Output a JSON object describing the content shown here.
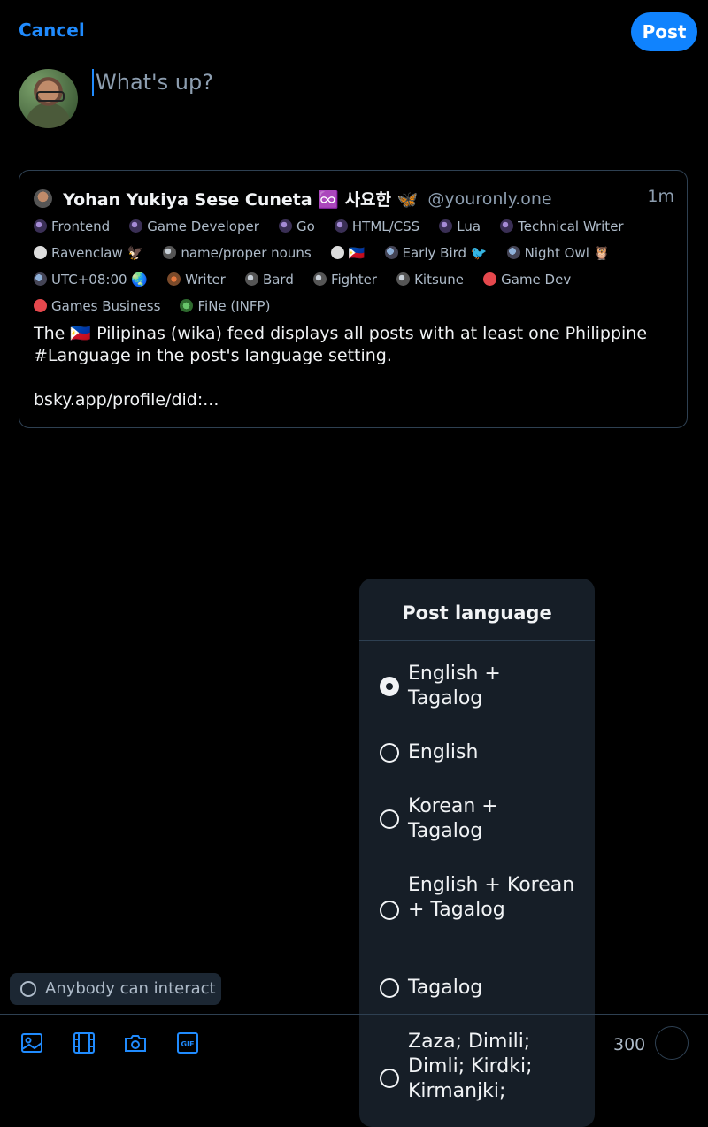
{
  "topbar": {
    "cancel_label": "Cancel",
    "post_label": "Post"
  },
  "composer": {
    "placeholder": "What's up?"
  },
  "quote": {
    "name": "Yohan Yukiya Sese Cuneta ♾️ 사요한 🦋",
    "handle": "@youronly.one",
    "time": "1m",
    "badges": [
      [
        "Frontend",
        "Game Developer",
        "Go",
        "HTML/CSS",
        "Lua",
        "Technical Writer"
      ],
      [
        "Ravenclaw 🦅",
        "name/proper nouns",
        "🇵🇭",
        "Early Bird 🐦",
        "Night Owl 🦉"
      ],
      [
        "UTC+08:00 🌏",
        "Writer",
        "Bard",
        "Fighter",
        "Kitsune",
        "Game Dev"
      ],
      [
        "Games Business",
        "FiNe (INFP)"
      ]
    ],
    "text": "The 🇵🇭 Pilipinas (wika) feed displays all posts with at least one Philippine #Language in the post's language setting.\n\nbsky.app/profile/did:..."
  },
  "language_menu": {
    "title": "Post language",
    "options": [
      {
        "label": "English + Tagalog",
        "checked": true
      },
      {
        "label": "English",
        "checked": false
      },
      {
        "label": "Korean + Tagalog",
        "checked": false
      },
      {
        "label": "English + Korean + Tagalog",
        "checked": false
      },
      {
        "label": "Tagalog",
        "checked": false
      },
      {
        "label": "Zaza; Dimili; Dimli; Kirdki; Kirmanjki;",
        "checked": false
      }
    ]
  },
  "footer": {
    "interact_label": "Anybody can interact",
    "char_count": "300",
    "tools": [
      "image-icon",
      "video-icon",
      "camera-icon",
      "gif-icon"
    ]
  },
  "colors": {
    "accent": "#1083fe",
    "background": "#000000",
    "menu_bg": "#161e27"
  }
}
